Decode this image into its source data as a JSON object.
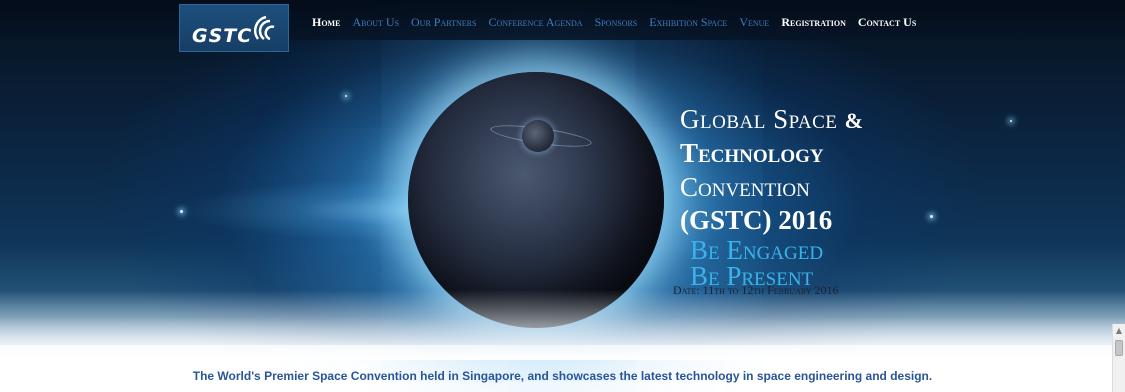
{
  "logo": {
    "text": "GSTC"
  },
  "nav": {
    "items": [
      {
        "label": "Home",
        "highlight": true
      },
      {
        "label": "About Us",
        "highlight": false
      },
      {
        "label": "Our Partners",
        "highlight": false
      },
      {
        "label": "Conference Agenda",
        "highlight": false
      },
      {
        "label": "Sponsors",
        "highlight": false
      },
      {
        "label": "Exhibition Space",
        "highlight": false
      },
      {
        "label": "Venue",
        "highlight": false
      },
      {
        "label": "Registration",
        "highlight": true
      },
      {
        "label": "Contact Us",
        "highlight": true
      }
    ]
  },
  "hero": {
    "headline": {
      "line1": "Global Space",
      "amp": "&",
      "line2": "Technology",
      "line3": "Convention",
      "line4": "(GSTC) 2016"
    },
    "tag1": "Be Engaged",
    "tag2": "Be Present",
    "date": "Date: 11th to 12th February 2016"
  },
  "tagline": "The World's Premier Space Convention held in Singapore, and showcases the latest technology in space engineering and design.",
  "colors": {
    "nav_link": "#3f7ec0",
    "nav_highlight": "#ffffff",
    "tag": "#3ab3ea",
    "tagline": "#2b5597",
    "logo_bg": "#1d4f7d"
  },
  "icons": {
    "logo_waves": "signal-waves-icon",
    "scroll_up": "chevron-up-icon"
  }
}
